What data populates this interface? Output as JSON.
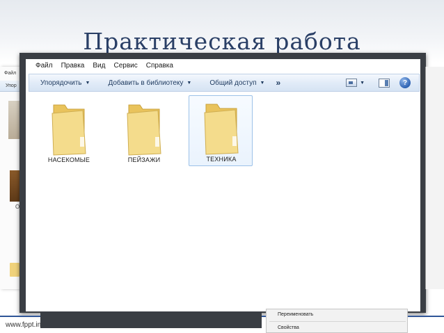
{
  "slide": {
    "title": "Практическая работа",
    "footer": "www.fppt.in"
  },
  "background_window": {
    "menu_text": "Файл",
    "toolbar_text": "Упор",
    "thumb_label": "О"
  },
  "explorer": {
    "menu": [
      "Файл",
      "Правка",
      "Вид",
      "Сервис",
      "Справка"
    ],
    "toolbar": {
      "organize": "Упорядочить",
      "add_to_library": "Добавить в библиотеку",
      "share": "Общий доступ",
      "more": "»",
      "help": "?"
    },
    "folders": [
      {
        "name": "НАСЕКОМЫЕ",
        "selected": false
      },
      {
        "name": "ПЕЙЗАЖИ",
        "selected": false
      },
      {
        "name": "ТЕХНИКА",
        "selected": true
      }
    ]
  },
  "context_menu": {
    "items": [
      "Переименовать",
      "Свойства"
    ]
  },
  "colors": {
    "title": "#2a3f66",
    "frame": "#3a3e44",
    "toolbar": "#dce7f5",
    "folder": "#f1d77f",
    "accent_line": "#2f5597"
  },
  "icons": [
    "folder-icon",
    "view-icon",
    "preview-pane-icon",
    "help-icon"
  ]
}
